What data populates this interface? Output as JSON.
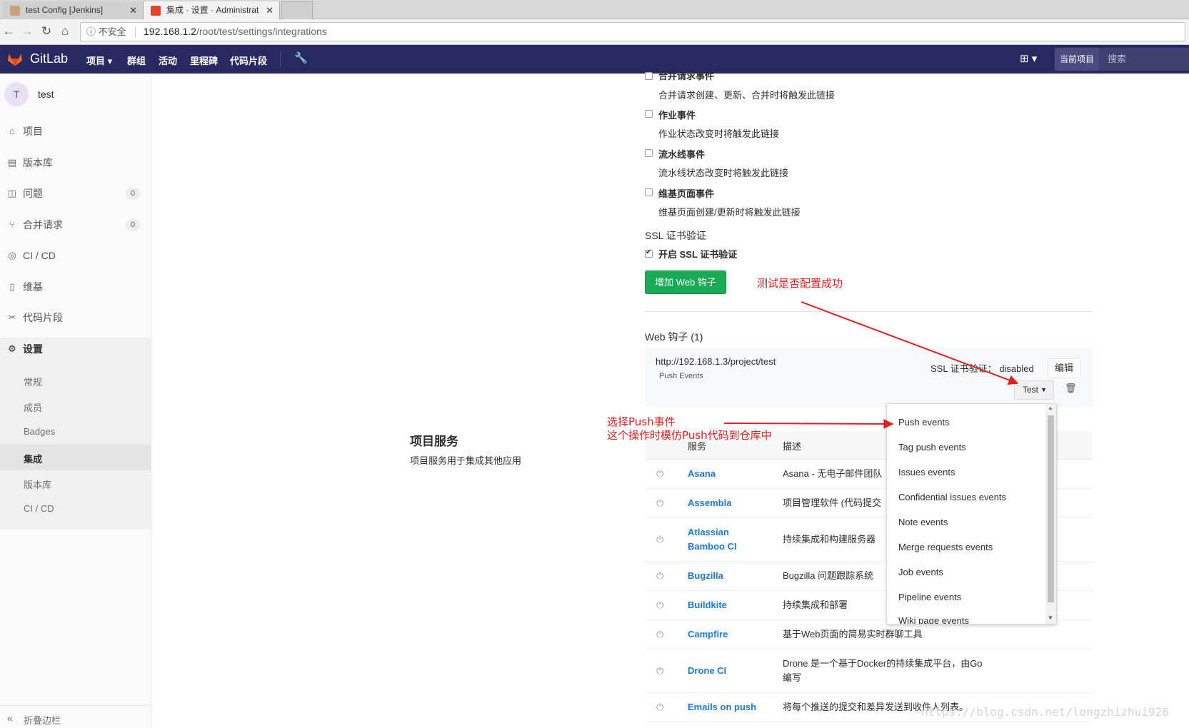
{
  "browser": {
    "tabs": [
      {
        "title": "test Config [Jenkins]",
        "close": "✕"
      },
      {
        "title": "集成 · 设置 · Administrat",
        "close": "✕"
      }
    ],
    "security_label": "不安全",
    "url_host": "192.168.1.2",
    "url_path": "/root/test/settings/integrations"
  },
  "header": {
    "brand": "GitLab",
    "nav": [
      "项目 ▾",
      "群组",
      "活动",
      "里程碑",
      "代码片段"
    ],
    "scope": "当前项目",
    "search_placeholder": "搜索"
  },
  "sidebar": {
    "avatar": "T",
    "project": "test",
    "items": [
      {
        "label": "项目",
        "icon": "home-icon"
      },
      {
        "label": "版本库",
        "icon": "doc-icon"
      },
      {
        "label": "问题",
        "icon": "issues-icon",
        "badge": "0"
      },
      {
        "label": "合并请求",
        "icon": "merge-icon",
        "badge": "0"
      },
      {
        "label": "CI / CD",
        "icon": "rocket-icon"
      },
      {
        "label": "维基",
        "icon": "book-icon"
      },
      {
        "label": "代码片段",
        "icon": "scissors-icon"
      },
      {
        "label": "设置",
        "icon": "gear-icon"
      }
    ],
    "sub_items": [
      "常规",
      "成员",
      "Badges",
      "集成",
      "版本库",
      "CI / CD"
    ],
    "collapse": "折叠边栏"
  },
  "events": [
    {
      "title": "合并请求事件",
      "desc": "合并请求创建、更新、合并时将触发此链接"
    },
    {
      "title": "作业事件",
      "desc": "作业状态改变时将触发此链接"
    },
    {
      "title": "流水线事件",
      "desc": "流水线状态改变时将触发此链接"
    },
    {
      "title": "维基页面事件",
      "desc": "维基页面创建/更新时将触发此链接"
    }
  ],
  "ssl": {
    "title": "SSL 证书验证",
    "option": "开启 SSL 证书验证"
  },
  "add_hook_button": "增加 Web 钩子",
  "annotations": {
    "test": "测试是否配置成功",
    "push_line1": "选择Push事件",
    "push_line2": "这个操作时模仿Push代码到仓库中"
  },
  "hooks": {
    "title": "Web 钩子 (1)",
    "url": "http://192.168.1.3/project/test",
    "events": "Push Events",
    "ssl_status": "SSL 证书验证： disabled",
    "edit": "编辑",
    "test": "Test"
  },
  "services": {
    "title": "项目服务",
    "subtitle": "项目服务用于集成其他应用",
    "col_service": "服务",
    "col_desc": "描述",
    "rows": [
      {
        "name": "Asana",
        "desc": "Asana - 无电子邮件团队"
      },
      {
        "name": "Assembla",
        "desc": "项目管理软件 (代码提交"
      },
      {
        "name": "Atlassian Bamboo CI",
        "desc": "持续集成和构建服务器"
      },
      {
        "name": "Bugzilla",
        "desc": "Bugzilla 问题跟踪系统"
      },
      {
        "name": "Buildkite",
        "desc": "持续集成和部署"
      },
      {
        "name": "Campfire",
        "desc": "基于Web页面的简易实时群聊工具"
      },
      {
        "name": "Drone CI",
        "desc": "Drone 是一个基于Docker的持续集成平台，由Go编写"
      },
      {
        "name": "Emails on push",
        "desc": "将每个推送的提交和差异发送到收件人列表。"
      }
    ]
  },
  "test_dropdown": [
    "Push events",
    "Tag push events",
    "Issues events",
    "Confidential issues events",
    "Note events",
    "Merge requests events",
    "Job events",
    "Pipeline events",
    "Wiki page events"
  ],
  "watermark": "https://blog.csdn.net/longzhizhui926",
  "colors": {
    "header_bg": "#292961",
    "add_button": "#1aaa55",
    "link": "#1f78d1",
    "annotation": "#e02020"
  }
}
